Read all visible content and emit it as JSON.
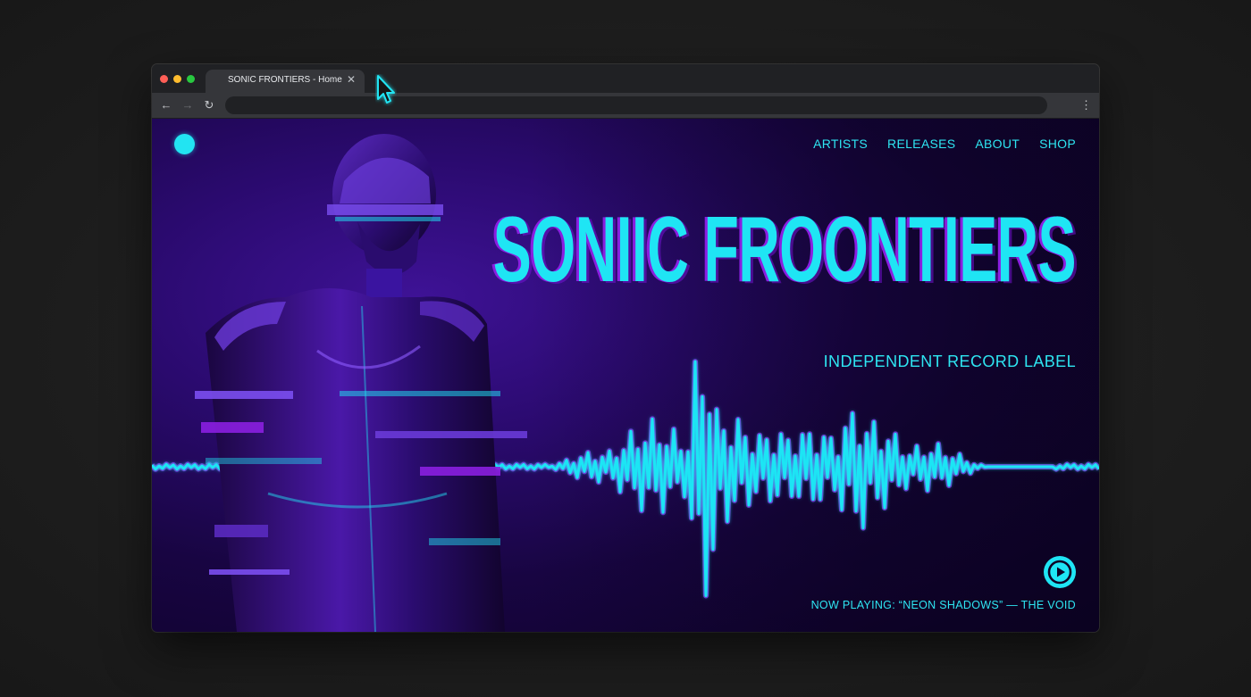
{
  "browser": {
    "tab_title": "SONIC FRONTIERS - Home",
    "tab_close_icon": "close-icon",
    "address_value": "",
    "traffic_lights": [
      "#ff5f57",
      "#febc2e",
      "#28c840"
    ]
  },
  "site": {
    "nav": [
      "ARTISTS",
      "RELEASES",
      "ABOUT",
      "SHOP"
    ],
    "title": "SONIIC FROONTIERS",
    "subtitle": "INDEPENDENT RECORD LABEL",
    "now_playing": "NOW PLAYING: “NEON SHADOWS” — THE VOID",
    "play_icon": "play-icon",
    "logo_icon": "logo-dot-icon"
  },
  "colors": {
    "accent": "#1fe5f4",
    "glitch_purple": "#8a1fe0",
    "background": "#1e1e1e"
  }
}
